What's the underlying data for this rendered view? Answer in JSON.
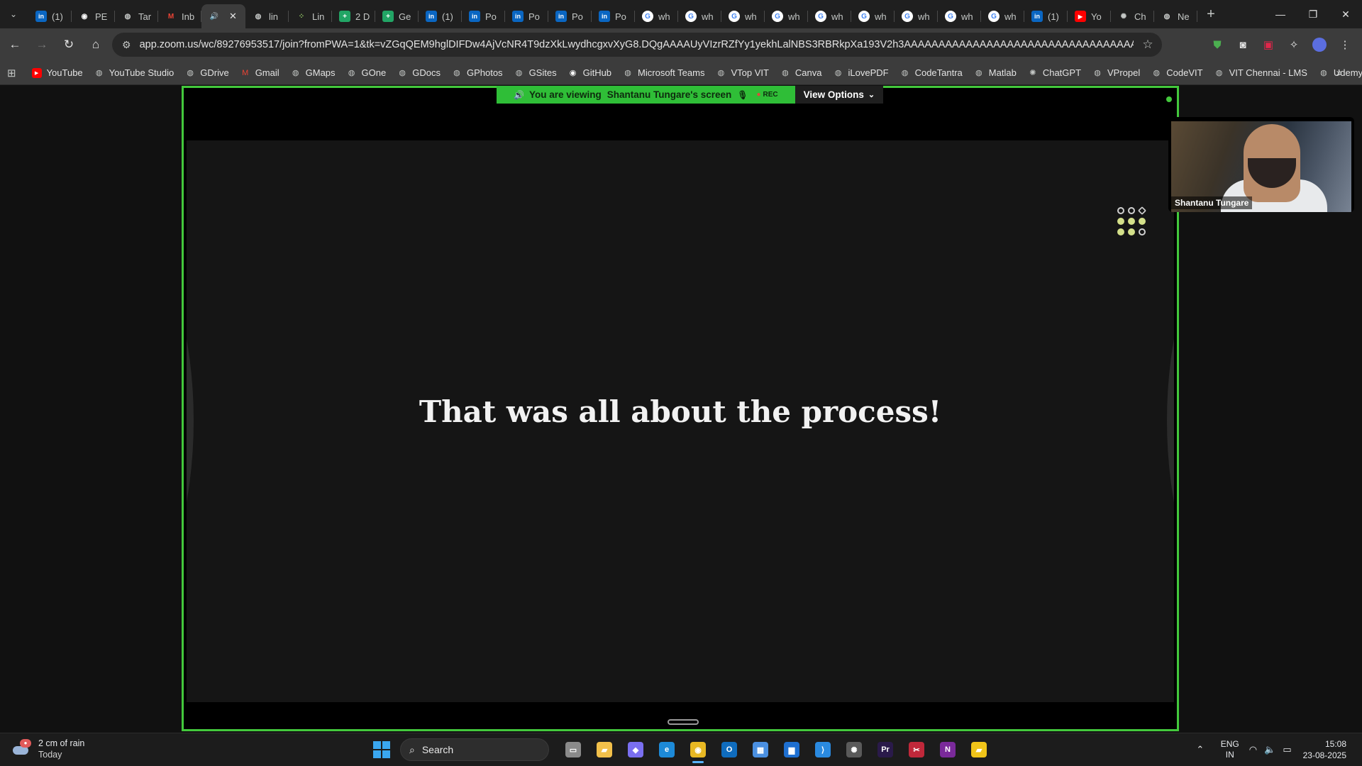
{
  "browser": {
    "tabs": [
      {
        "label": "(1)",
        "icon": "linkedin-icon",
        "color": "#0a66c2",
        "glyph": "in"
      },
      {
        "label": "PE",
        "icon": "github-icon",
        "color": "#ffffff",
        "glyph": "◉"
      },
      {
        "label": "Tar",
        "icon": "globe-icon",
        "color": "#c4c7c5",
        "glyph": "◍"
      },
      {
        "label": "Inb",
        "icon": "gmail-icon",
        "color": "#ea4335",
        "glyph": "M"
      },
      {
        "label": "",
        "icon": "speaker-icon",
        "color": "#e3e3e3",
        "glyph": "🔊",
        "active": true,
        "close": "✕"
      },
      {
        "label": "lin",
        "icon": "globe-icon",
        "color": "#c4c7c5",
        "glyph": "◍"
      },
      {
        "label": "Lin",
        "icon": "dots-app-icon",
        "color": "#9bd36a",
        "glyph": "⁘"
      },
      {
        "label": "2 D",
        "icon": "sheets-icon",
        "color": "#22a565",
        "glyph": "+"
      },
      {
        "label": "Ge",
        "icon": "sheets-icon",
        "color": "#22a565",
        "glyph": "+"
      },
      {
        "label": "(1)",
        "icon": "linkedin-icon",
        "color": "#0a66c2",
        "glyph": "in"
      },
      {
        "label": "Po",
        "icon": "linkedin-icon",
        "color": "#0a66c2",
        "glyph": "in"
      },
      {
        "label": "Po",
        "icon": "linkedin-icon",
        "color": "#0a66c2",
        "glyph": "in"
      },
      {
        "label": "Po",
        "icon": "linkedin-icon",
        "color": "#0a66c2",
        "glyph": "in"
      },
      {
        "label": "Po",
        "icon": "linkedin-icon",
        "color": "#0a66c2",
        "glyph": "in"
      },
      {
        "label": "wh",
        "icon": "google-icon",
        "color": "#ffffff",
        "glyph": "G"
      },
      {
        "label": "wh",
        "icon": "google-icon",
        "color": "#ffffff",
        "glyph": "G"
      },
      {
        "label": "wh",
        "icon": "google-icon",
        "color": "#ffffff",
        "glyph": "G"
      },
      {
        "label": "wh",
        "icon": "google-icon",
        "color": "#ffffff",
        "glyph": "G"
      },
      {
        "label": "wh",
        "icon": "google-icon",
        "color": "#ffffff",
        "glyph": "G"
      },
      {
        "label": "wh",
        "icon": "google-icon",
        "color": "#ffffff",
        "glyph": "G"
      },
      {
        "label": "wh",
        "icon": "google-icon",
        "color": "#ffffff",
        "glyph": "G"
      },
      {
        "label": "wh",
        "icon": "google-icon",
        "color": "#ffffff",
        "glyph": "G"
      },
      {
        "label": "wh",
        "icon": "google-icon",
        "color": "#ffffff",
        "glyph": "G"
      },
      {
        "label": "(1)",
        "icon": "linkedin-icon",
        "color": "#0a66c2",
        "glyph": "in"
      },
      {
        "label": "Yo",
        "icon": "youtube-icon",
        "color": "#ff0000",
        "glyph": "▶"
      },
      {
        "label": "Ch",
        "icon": "chatgpt-icon",
        "color": "#c4c7c5",
        "glyph": "✺"
      },
      {
        "label": "Ne",
        "icon": "globe-icon",
        "color": "#c4c7c5",
        "glyph": "◍"
      }
    ],
    "new_tab": "+",
    "url": "app.zoom.us/wc/89276953517/join?fromPWA=1&tk=vZGqQEM9hglDIFDw4AjVcNR4T9dzXkLwydhcgxvXyG8.DQgAAAAUyVIzrRZfYy1yekhLalNBS3RBRkpXa193V2h3AAAAAAAAAAAAAAAAAAAAAAAAAAAAAAAAAAAAAAAAAAAA&_x_zm_r...",
    "bookmarks": [
      {
        "label": "YouTube",
        "icon": "youtube-icon",
        "color": "#ff0000"
      },
      {
        "label": "YouTube Studio",
        "icon": "globe-icon",
        "color": "#c4c7c5"
      },
      {
        "label": "GDrive",
        "icon": "globe-icon",
        "color": "#c4c7c5"
      },
      {
        "label": "Gmail",
        "icon": "gmail-icon",
        "color": "#ea4335"
      },
      {
        "label": "GMaps",
        "icon": "globe-icon",
        "color": "#c4c7c5"
      },
      {
        "label": "GOne",
        "icon": "globe-icon",
        "color": "#c4c7c5"
      },
      {
        "label": "GDocs",
        "icon": "globe-icon",
        "color": "#c4c7c5"
      },
      {
        "label": "GPhotos",
        "icon": "globe-icon",
        "color": "#c4c7c5"
      },
      {
        "label": "GSites",
        "icon": "globe-icon",
        "color": "#c4c7c5"
      },
      {
        "label": "GitHub",
        "icon": "github-icon",
        "color": "#ffffff"
      },
      {
        "label": "Microsoft Teams",
        "icon": "globe-icon",
        "color": "#c4c7c5"
      },
      {
        "label": "VTop VIT",
        "icon": "globe-icon",
        "color": "#c4c7c5"
      },
      {
        "label": "Canva",
        "icon": "globe-icon",
        "color": "#c4c7c5"
      },
      {
        "label": "iLovePDF",
        "icon": "globe-icon",
        "color": "#c4c7c5"
      },
      {
        "label": "CodeTantra",
        "icon": "globe-icon",
        "color": "#c4c7c5"
      },
      {
        "label": "Matlab",
        "icon": "globe-icon",
        "color": "#c4c7c5"
      },
      {
        "label": "ChatGPT",
        "icon": "chatgpt-icon",
        "color": "#c4c7c5"
      },
      {
        "label": "VPropel",
        "icon": "globe-icon",
        "color": "#c4c7c5"
      },
      {
        "label": "CodeVIT",
        "icon": "globe-icon",
        "color": "#c4c7c5"
      },
      {
        "label": "VIT Chennai - LMS",
        "icon": "globe-icon",
        "color": "#c4c7c5"
      },
      {
        "label": "Udemy",
        "icon": "globe-icon",
        "color": "#c4c7c5"
      }
    ]
  },
  "zoom": {
    "viewing_prefix": "You are viewing",
    "viewing_name": "Shantanu Tungare's screen",
    "rec_label": "REC",
    "view_options": "View Options",
    "slide_title": "That was all about the process!",
    "participant_name": "Shantanu Tungare",
    "frame_color": "#43c83c"
  },
  "taskbar": {
    "weather_title": "2 cm of rain",
    "weather_sub": "Today",
    "search_label": "Search",
    "apps": [
      {
        "name": "task-view-icon",
        "glyph": "▭",
        "color": "#8a8a8a"
      },
      {
        "name": "file-explorer-icon",
        "glyph": "▰",
        "color": "#f2c04a"
      },
      {
        "name": "copilot-icon",
        "glyph": "◆",
        "color": "#7a6ff0"
      },
      {
        "name": "edge-icon",
        "glyph": "e",
        "color": "#1d8ad8"
      },
      {
        "name": "chrome-icon",
        "glyph": "◉",
        "color": "#e8b823",
        "active": true
      },
      {
        "name": "outlook-icon",
        "glyph": "O",
        "color": "#0f6cbd"
      },
      {
        "name": "store-icon",
        "glyph": "▦",
        "color": "#4a8fe0"
      },
      {
        "name": "word-app-icon",
        "glyph": "▆",
        "color": "#1e6fd0"
      },
      {
        "name": "vscode-icon",
        "glyph": "⟩",
        "color": "#2a8ae0"
      },
      {
        "name": "chatgpt-app-icon",
        "glyph": "✺",
        "color": "#5a5a5a"
      },
      {
        "name": "premiere-icon",
        "glyph": "Pr",
        "color": "#2a1a4a"
      },
      {
        "name": "snipping-tool-icon",
        "glyph": "✂",
        "color": "#c0283a"
      },
      {
        "name": "onenote-icon",
        "glyph": "N",
        "color": "#7a2a9a"
      },
      {
        "name": "sticky-notes-icon",
        "glyph": "▰",
        "color": "#f0c419"
      }
    ],
    "lang_top": "ENG",
    "lang_bottom": "IN",
    "time": "15:08",
    "date": "23-08-2025"
  }
}
